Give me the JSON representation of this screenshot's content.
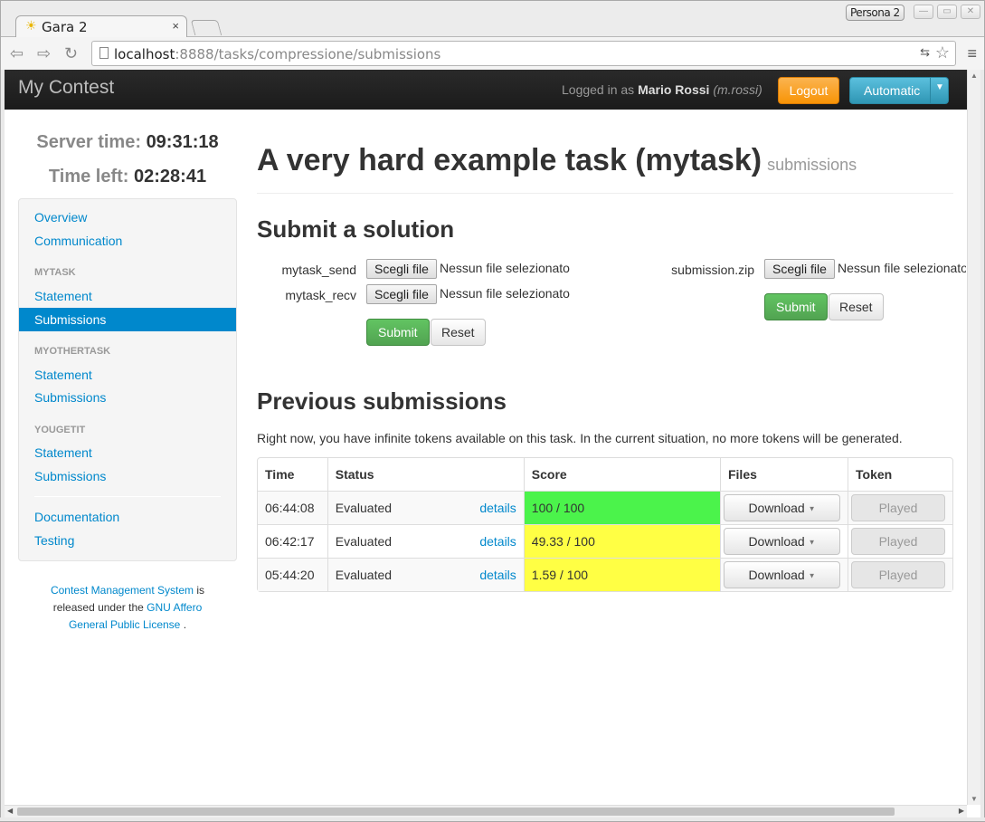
{
  "browser": {
    "tab_title": "Gara 2",
    "tab_close": "×",
    "persona": "Persona 2",
    "url_host": "localhost",
    "url_path": ":8888/tasks/compressione/submissions"
  },
  "navbar": {
    "brand": "My Contest",
    "logged_prefix": "Logged in as",
    "user_name": "Mario Rossi",
    "user_login": "(m.rossi)",
    "logout_label": "Logout",
    "language_label": "Automatic"
  },
  "clock": {
    "server_label": "Server time:",
    "server_value": "09:31:18",
    "left_label": "Time left:",
    "left_value": "02:28:41"
  },
  "sidebar": {
    "overview": "Overview",
    "communication": "Communication",
    "groups": [
      {
        "header": "MYTASK",
        "statement": "Statement",
        "submissions": "Submissions"
      },
      {
        "header": "MYOTHERTASK",
        "statement": "Statement",
        "submissions": "Submissions"
      },
      {
        "header": "YOUGETIT",
        "statement": "Statement",
        "submissions": "Submissions"
      }
    ],
    "documentation": "Documentation",
    "testing": "Testing",
    "footer": {
      "cms_link": "Contest Management System",
      "is": "is",
      "released": "released under the",
      "license_link_1": "GNU Affero",
      "license_link_2": "General Public License",
      "dot": "."
    }
  },
  "main": {
    "title": "A very hard example task (mytask)",
    "subtitle": "submissions",
    "submit_heading": "Submit a solution",
    "form_left": {
      "field1_label": "mytask_send",
      "field2_label": "mytask_recv",
      "choose_label": "Scegli file",
      "no_file": "Nessun file selezionato",
      "submit_label": "Submit",
      "reset_label": "Reset"
    },
    "form_right": {
      "field_label": "submission.zip",
      "choose_label": "Scegli file",
      "no_file": "Nessun file selezionato",
      "submit_label": "Submit",
      "reset_label": "Reset"
    },
    "previous_heading": "Previous submissions",
    "tokens_info": "Right now, you have infinite tokens available on this task. In the current situation, no more tokens will be generated.",
    "table": {
      "headers": [
        "Time",
        "Status",
        "Score",
        "Files",
        "Token"
      ],
      "rows": [
        {
          "time": "06:44:08",
          "status": "Evaluated",
          "details": "details",
          "score": "100 / 100",
          "files": "Download",
          "token": "Played"
        },
        {
          "time": "06:42:17",
          "status": "Evaluated",
          "details": "details",
          "score": "49.33 / 100",
          "files": "Download",
          "token": "Played"
        },
        {
          "time": "05:44:20",
          "status": "Evaluated",
          "details": "details",
          "score": "1.59 / 100",
          "files": "Download",
          "token": "Played"
        }
      ]
    }
  },
  "colors": {
    "score_full": "#4bf34b",
    "score_partial": "#ffff44",
    "link": "#0088cc",
    "submit_green": "#51a351",
    "logout_orange": "#f89406"
  }
}
